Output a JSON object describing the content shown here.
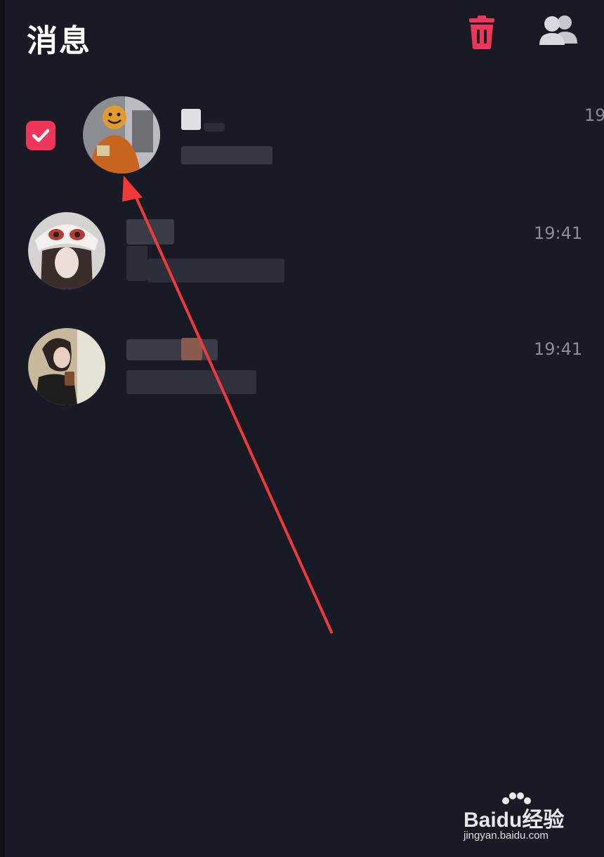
{
  "header": {
    "title": "消息",
    "delete_icon": "trash-icon",
    "contacts_icon": "contacts-icon",
    "accent_color": "#f0355a"
  },
  "conversations": [
    {
      "selected": true,
      "time": "19",
      "avatar": "avatar-smiley-orange"
    },
    {
      "selected": false,
      "time": "19:41",
      "avatar": "avatar-bear-hat"
    },
    {
      "selected": false,
      "time": "19:41",
      "avatar": "avatar-coffee"
    }
  ],
  "annotation": {
    "arrow_color": "#f03a3a"
  },
  "watermark": {
    "brand": "Baidu经验",
    "url": "jingyan.baidu.com"
  }
}
